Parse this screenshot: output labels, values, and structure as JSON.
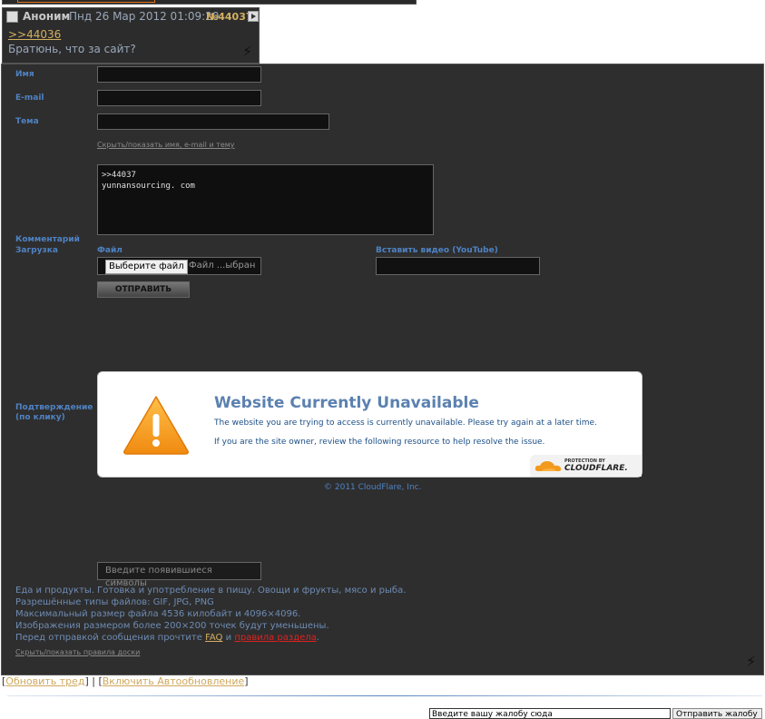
{
  "post": {
    "author": "Аноним",
    "date": "Пнд 26 Мар 2012 01:09:20",
    "number": "№44037",
    "reply_link": ">>44036",
    "message": "Братюнь, что за сайт?"
  },
  "form": {
    "name_label": "Имя",
    "email_label": "E-mail",
    "subject_label": "Тема",
    "toggle_fields_link": "Скрыть/показать имя, e-mail и тему",
    "comment_label": "Комментарий",
    "comment_value": ">>44037\nyunnansourcing. com",
    "upload_label": "Загрузка",
    "file_label": "Файл",
    "file_button": "Выберите файл",
    "file_status": "Файл ...ыбран",
    "video_label": "Вставить видео (YouTube)",
    "submit_label": "ОТПРАВИТЬ",
    "confirm_label": "Подтверждение",
    "confirm_sub": "(по клику)",
    "captcha_placeholder": "Введите появившиеся символы"
  },
  "cloudflare": {
    "title": "Website Currently Unavailable",
    "line1": "The website you are trying to access is currently unavailable. Please try again at a later time.",
    "line2": "If you are the site owner, review the following resource to help resolve the issue.",
    "badge_small": "PROTECTION BY",
    "badge_name": "CLOUDFLARE.",
    "copyright": "© 2011 CloudFlare, Inc."
  },
  "rules": {
    "line1": "Еда и продукты. Готовка и употребление в пищу. Овощи и фрукты, мясо и рыба.",
    "line2": "Разрешённые типы файлов: GIF, JPG, PNG",
    "line3": "Максимальный размер файла 4536 килобайт и 4096×4096.",
    "line4": "Изображения размером более 200×200 точек будут уменьшены.",
    "line5_prefix": "Перед отправкой сообщения прочтите",
    "faq": "FAQ",
    "and": "и",
    "section_rules": "правила раздела",
    "toggle_rules_link": "Скрыть/показать правила доски"
  },
  "footer": {
    "refresh_thread": "Обновить тред",
    "auto_update": "Включить Автообновление",
    "complaint_placeholder": "Введите вашу жалобу сюда",
    "complaint_button": "Отправить жалобу"
  },
  "colors": {
    "panel_bg": "#2e2e2e",
    "label_blue": "#4f82c3",
    "link_gold": "#d4b062",
    "rules_red": "#e02020",
    "cf_orange": "#f39a1e"
  }
}
